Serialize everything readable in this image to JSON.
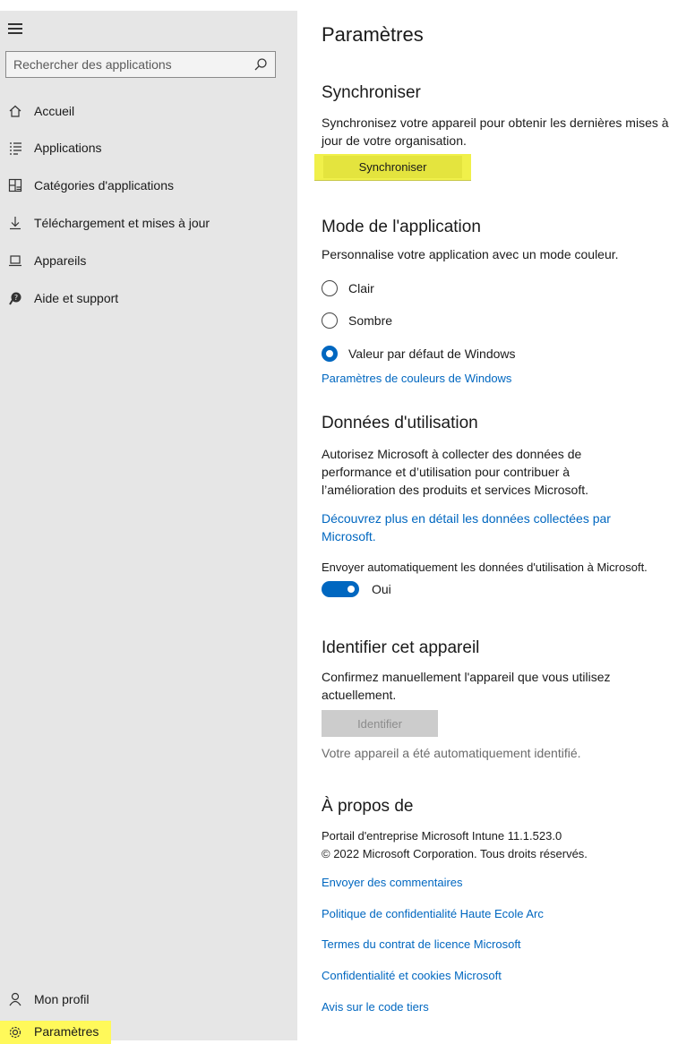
{
  "sidebar": {
    "search": {
      "placeholder": "Rechercher des applications"
    },
    "items": [
      {
        "label": "Accueil",
        "icon": "home-icon"
      },
      {
        "label": "Applications",
        "icon": "list-icon"
      },
      {
        "label": "Catégories d'applications",
        "icon": "categories-icon"
      },
      {
        "label": "Téléchargement et mises à jour",
        "icon": "download-icon"
      },
      {
        "label": "Appareils",
        "icon": "device-icon"
      },
      {
        "label": "Aide et support",
        "icon": "help-icon"
      }
    ],
    "bottom": [
      {
        "label": "Mon profil",
        "icon": "person-icon"
      },
      {
        "label": "Paramètres",
        "icon": "gear-icon",
        "highlighted": true
      }
    ]
  },
  "main": {
    "title": "Paramètres",
    "sync": {
      "heading": "Synchroniser",
      "description": "Synchronisez votre appareil pour obtenir les dernières mises à jour de votre organisation.",
      "button": "Synchroniser"
    },
    "app_mode": {
      "heading": "Mode de l'application",
      "description": "Personnalise votre application avec un mode couleur.",
      "options": [
        {
          "label": "Clair",
          "selected": false
        },
        {
          "label": "Sombre",
          "selected": false
        },
        {
          "label": "Valeur par défaut de Windows",
          "selected": true
        }
      ],
      "link": "Paramètres de couleurs de Windows"
    },
    "usage": {
      "heading": "Données d'utilisation",
      "description": "Autorisez Microsoft à collecter des données de performance et d’utilisation pour contribuer à l’amélioration des produits et services Microsoft.",
      "link": "Découvrez plus en détail les données collectées par Microsoft.",
      "toggle_label": "Envoyer automatiquement les données d'utilisation à Microsoft.",
      "toggle_value": "Oui"
    },
    "identify": {
      "heading": "Identifier cet appareil",
      "description": "Confirmez manuellement l'appareil que vous utilisez actuellement.",
      "button": "Identifier",
      "status": "Votre appareil a été automatiquement identifié."
    },
    "about": {
      "heading": "À propos de",
      "line1": "Portail d'entreprise Microsoft Intune 11.1.523.0",
      "line2": "© 2022 Microsoft Corporation. Tous droits réservés.",
      "links": [
        "Envoyer des commentaires",
        "Politique de confidentialité Haute Ecole Arc",
        "Termes du contrat de licence Microsoft",
        "Confidentialité et cookies Microsoft",
        "Avis sur le code tiers"
      ]
    }
  },
  "colors": {
    "accent": "#0067c0",
    "highlight": "#fff95a",
    "sidebar_bg": "#e6e6e6"
  }
}
